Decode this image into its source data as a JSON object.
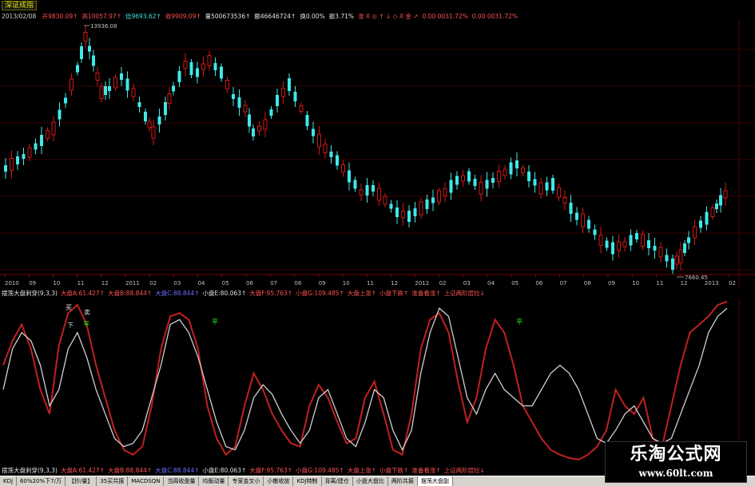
{
  "window": {
    "title": "深证成指"
  },
  "info_bar": {
    "date": "2013/02/08",
    "items": [
      {
        "text": "开9830.09↑",
        "color": "red"
      },
      {
        "text": "高10057.97↑",
        "color": "red"
      },
      {
        "text": "低9693.62↑",
        "color": "cyan"
      },
      {
        "text": "收9909.09↑",
        "color": "red"
      },
      {
        "text": "量500673536↑",
        "color": "white"
      },
      {
        "text": "额46646724↑",
        "color": "white"
      },
      {
        "text": "换0.00%",
        "color": "white"
      },
      {
        "text": "振3.71%",
        "color": "white"
      },
      {
        "text": "涨 X ◎ ↑ ↓ ◇ X 金 ↗",
        "color": "red"
      },
      {
        "text": "0.00 0031.72%",
        "color": "red"
      },
      {
        "text": "0.00 0031.72%",
        "color": "red"
      }
    ]
  },
  "main_chart": {
    "high_label": "13936.08",
    "low_label": "7660.45",
    "x_labels": [
      "2010",
      "09",
      "10",
      "11",
      "12",
      "2011",
      "02",
      "03",
      "04",
      "05",
      "06",
      "07",
      "08",
      "09",
      "10",
      "11",
      "12",
      "2012",
      "02",
      "03",
      "04",
      "05",
      "06",
      "07",
      "08",
      "09",
      "10",
      "11",
      "12",
      "2013",
      "02"
    ]
  },
  "indicator": {
    "header_items": [
      {
        "text": "摆荡大盘刺穿(9,3,3)",
        "color": "white"
      },
      {
        "text": "大盘A:61.427↑",
        "color": "red"
      },
      {
        "text": "大盘B:88.844↑",
        "color": "red"
      },
      {
        "text": "大盘C:88.844↑",
        "color": "blue"
      },
      {
        "text": "小盘E:80.063↑",
        "color": "white"
      },
      {
        "text": "大盘F:95.763↑",
        "color": "red"
      },
      {
        "text": "小盘G:109.485↑",
        "color": "red"
      },
      {
        "text": "大盘上涨↑",
        "color": "red"
      },
      {
        "text": "小盘下跌↑",
        "color": "red"
      },
      {
        "text": "准备看涨↑",
        "color": "red"
      },
      {
        "text": "上证两阶层拉↓",
        "color": "red"
      }
    ],
    "footer_items": [
      {
        "text": "摆荡大盘刺穿(9,3,3)",
        "color": "white"
      },
      {
        "text": "大盘A:61.427↑",
        "color": "red"
      },
      {
        "text": "大盘B:88.844↑",
        "color": "red"
      },
      {
        "text": "大盘C:88.844↑",
        "color": "blue"
      },
      {
        "text": "小盘E:80.063↑",
        "color": "white"
      },
      {
        "text": "大盘F:95.763↑",
        "color": "red"
      },
      {
        "text": "小盘G:109.485↑",
        "color": "red"
      },
      {
        "text": "大盘上涨↑",
        "color": "red"
      },
      {
        "text": "小盘下跌↑",
        "color": "red"
      },
      {
        "text": "准备看涨↑",
        "color": "red"
      },
      {
        "text": "上证两阶层拉↓",
        "color": "red"
      }
    ],
    "markers": [
      "买",
      "卖",
      "下",
      "平",
      "平",
      "平"
    ],
    "series": [
      {
        "name": "大盘",
        "color": "#c02020",
        "values": [
          60,
          75,
          85,
          70,
          45,
          30,
          72,
          92,
          97,
          85,
          60,
          40,
          20,
          8,
          5,
          10,
          35,
          70,
          90,
          92,
          88,
          70,
          35,
          15,
          5,
          10,
          35,
          55,
          45,
          30,
          20,
          12,
          10,
          35,
          48,
          40,
          25,
          12,
          15,
          40,
          50,
          30,
          8,
          5,
          30,
          70,
          88,
          92,
          80,
          50,
          25,
          40,
          70,
          88,
          80,
          60,
          35,
          25,
          15,
          8,
          5,
          3,
          2,
          5,
          10,
          20,
          45,
          35,
          30,
          40,
          15,
          10,
          35,
          60,
          80,
          85,
          90,
          97,
          99
        ]
      },
      {
        "name": "小盘",
        "color": "#d0d0d0",
        "values": [
          45,
          70,
          80,
          75,
          60,
          35,
          45,
          70,
          80,
          65,
          45,
          30,
          15,
          10,
          12,
          20,
          40,
          60,
          85,
          88,
          80,
          65,
          45,
          25,
          10,
          8,
          20,
          40,
          48,
          42,
          30,
          20,
          12,
          20,
          40,
          45,
          30,
          15,
          10,
          25,
          45,
          40,
          20,
          8,
          20,
          55,
          80,
          95,
          90,
          65,
          40,
          30,
          45,
          55,
          45,
          40,
          35,
          35,
          45,
          55,
          60,
          55,
          45,
          30,
          15,
          12,
          20,
          30,
          35,
          25,
          15,
          12,
          15,
          30,
          45,
          60,
          80,
          90,
          95
        ]
      }
    ]
  },
  "tabs": [
    "KDJ",
    "60%20%下7/万",
    "【抄/量】",
    "35买共振",
    "MACDSQN",
    "当周收盘量",
    "均衡动量",
    "专家金叉小",
    "小散收放",
    "KDJ特制",
    "背离/建仓",
    "小盘大盘比",
    "两阶共振",
    "摆荡大盘副"
  ],
  "watermark": {
    "title": "乐淘公式网",
    "url": "www.60lt.com"
  }
}
